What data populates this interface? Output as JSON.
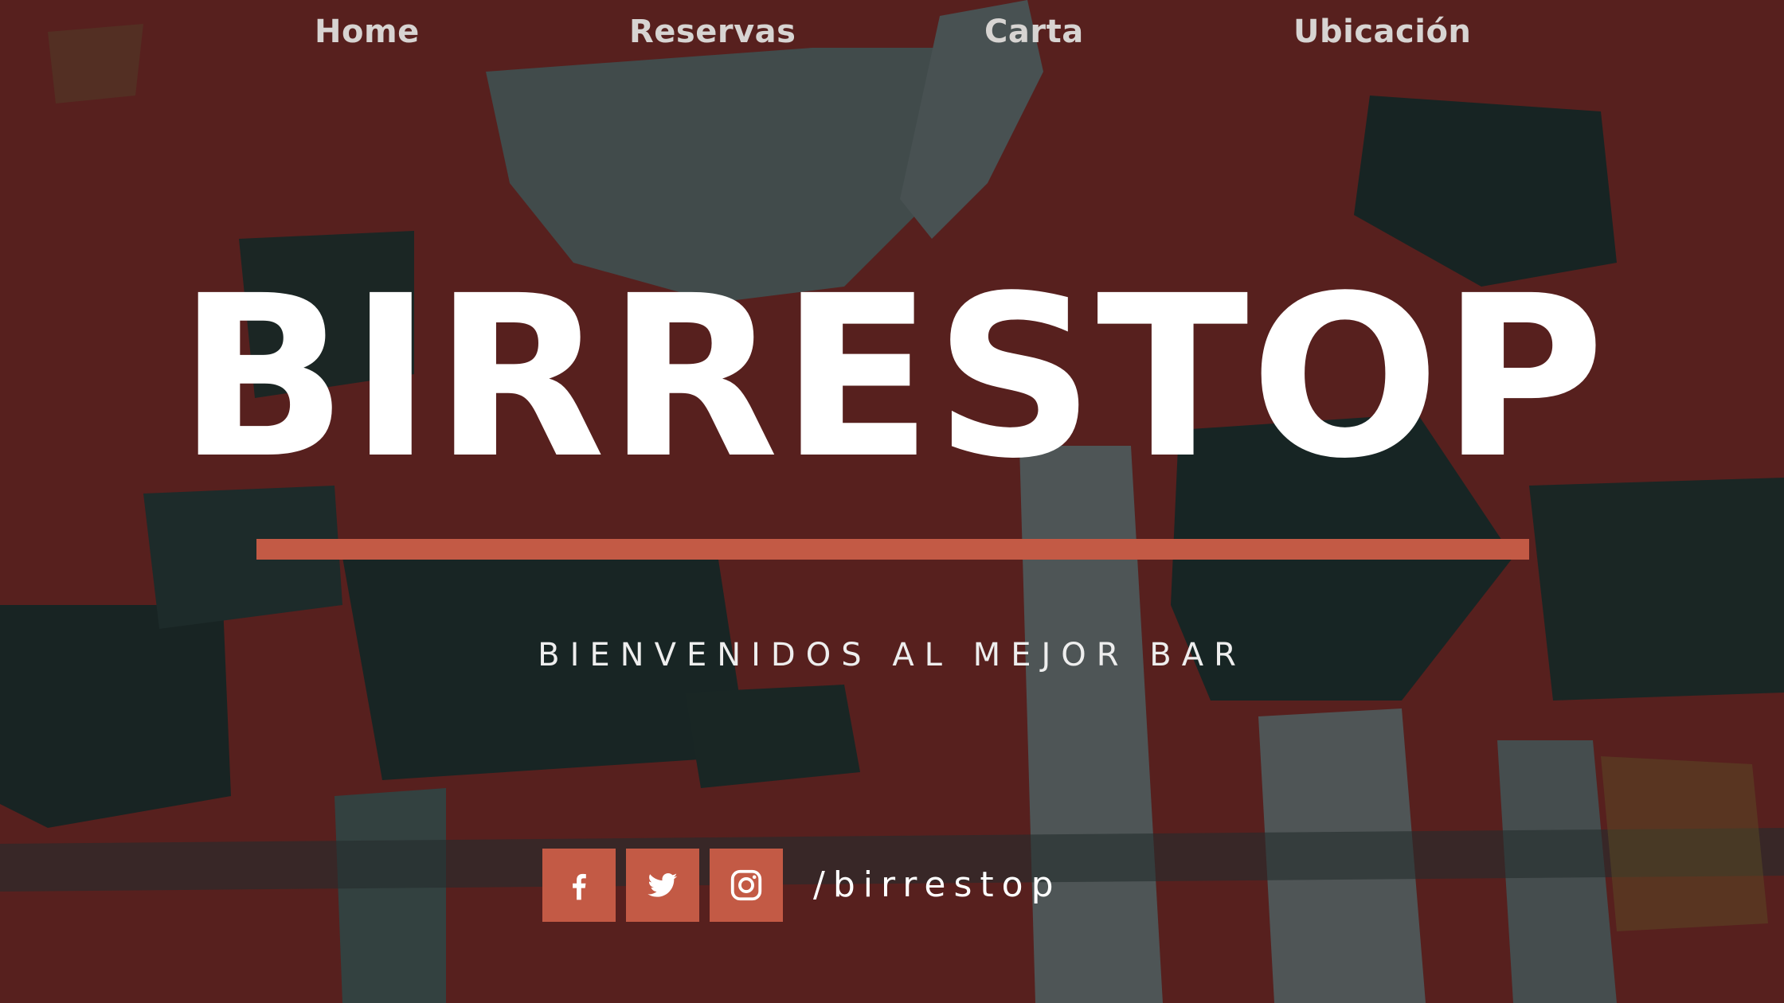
{
  "nav": {
    "items": [
      {
        "label": "Home"
      },
      {
        "label": "Reservas"
      },
      {
        "label": "Carta"
      },
      {
        "label": "Ubicación"
      }
    ]
  },
  "hero": {
    "title": "BIRRESTOP",
    "subtitle": "BIENVENIDOS AL MEJOR BAR"
  },
  "social": {
    "icons": [
      "facebook-icon",
      "twitter-icon",
      "instagram-icon"
    ],
    "handle": "/birrestop"
  },
  "colors": {
    "accent": "#c35a45",
    "background_red": "#6e2420",
    "background_dark": "#1c2b29",
    "background_grey": "#4f5a5a",
    "text": "#ffffff",
    "nav_text": "#d7d4d2"
  }
}
